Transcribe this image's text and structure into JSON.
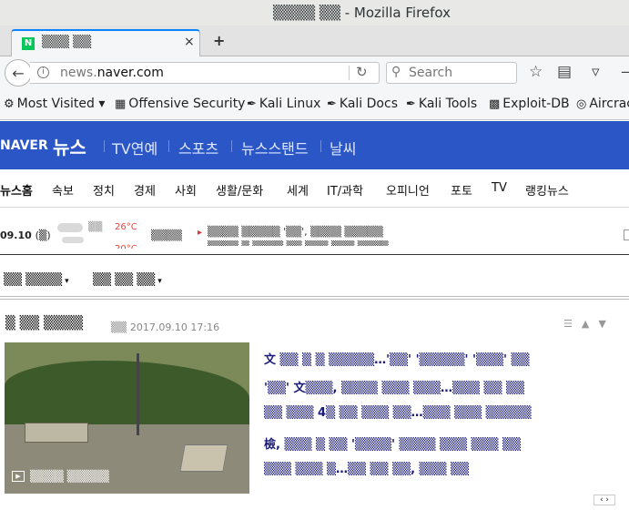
{
  "window": {
    "title": "▒▒▒▒ ▒▒ - Mozilla Firefox"
  },
  "tab": {
    "title": "▒▒▒ ▒▒",
    "favicon_letter": "N",
    "close": "×",
    "new_tab": "+"
  },
  "navbar": {
    "url_prefix": "news.",
    "url_domain": "naver.com",
    "search_placeholder": "Search"
  },
  "bookmarks": [
    {
      "label": "Most Visited ▾",
      "icon": "gear-icon"
    },
    {
      "label": "Offensive Security",
      "icon": "offsec-icon"
    },
    {
      "label": "Kali Linux",
      "icon": "kali-icon"
    },
    {
      "label": "Kali Docs",
      "icon": "kali-icon"
    },
    {
      "label": "Kali Tools",
      "icon": "kali-icon"
    },
    {
      "label": "Exploit-DB",
      "icon": "exploitdb-icon"
    },
    {
      "label": "Aircrack",
      "icon": "aircrack-icon"
    }
  ],
  "naver": {
    "logo": "NAVER",
    "section": "뉴스",
    "services": [
      "TV연예",
      "스포츠",
      "뉴스스탠드",
      "날씨"
    ]
  },
  "categories": [
    "뉴스홈",
    "속보",
    "정치",
    "경제",
    "사회",
    "생활/문화",
    "세계",
    "IT/과학",
    "오피니언",
    "포토",
    "TV",
    "랭킹뉴스"
  ],
  "ticker": {
    "date": "09.10",
    "day": "(▒)",
    "weather_label": "▒▒",
    "temp": "26°C",
    "temp2": "20°C",
    "tag": "▒▒▒▒",
    "headline": "▒▒▒▒ ▒▒▒▒▒ '▒▒', ▒▒▒▒ ▒▒▒▒▒",
    "headline2": "▒▒▒▒ ▒ ▒▒▒▒ ▒▒ ▒▒▒ ▒▒▒ ▒▒▒▒"
  },
  "filters": [
    "▒▒ ▒▒▒▒",
    "▒▒ ▒▒ ▒▒"
  ],
  "article": {
    "section": "▒ ▒▒ ▒▒▒▒",
    "source": "▒▒",
    "datetime": "2017.09.10 17:16",
    "thumb_caption": "▒▒▒▒ ▒▒▒▒▒",
    "lines": [
      "文 ▒▒ ▒ ▒ ▒▒▒▒▒…'▒▒' '▒▒▒▒▒' '▒▒▒' ▒▒",
      "'▒▒' 文▒▒▒, ▒▒▒▒ ▒▒▒ ▒▒▒…▒▒▒ ▒▒ ▒▒",
      "▒▒ ▒▒▒ 4▒ ▒▒ ▒▒▒ ▒▒…▒▒▒ ▒▒▒ ▒▒▒▒▒",
      "檢, ▒▒▒ ▒ ▒▒ '▒▒▒▒' ▒▒▒▒ ▒▒▒ ▒▒▒ ▒▒",
      "▒▒▒ ▒▒▒ ▒…▒▒ ▒▒ ▒▒, ▒▒▒ ▒▒"
    ]
  },
  "pager": "‹ ›",
  "colors": {
    "naver_blue": "#2a56c6",
    "firefox_accent": "#0a84ff",
    "temp_red": "#e8453c"
  }
}
